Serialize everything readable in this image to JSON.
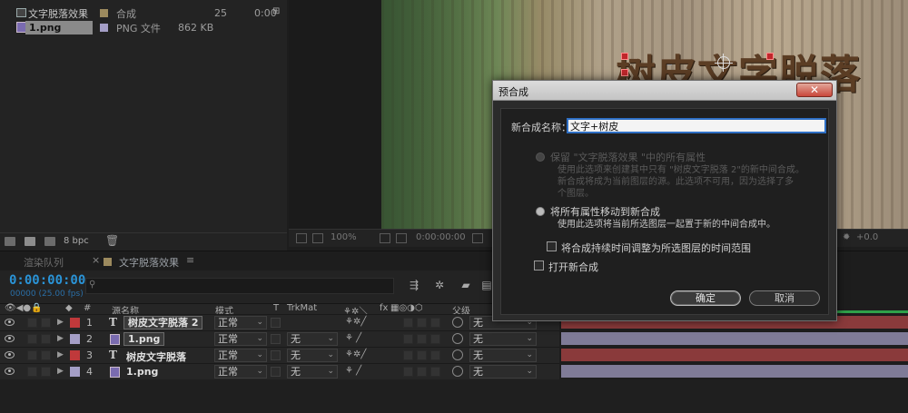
{
  "project": {
    "items": [
      {
        "name": "文字脱落效果",
        "type": "合成",
        "size": "",
        "fps": "25",
        "duration": "0:00",
        "swatch": "#9c8a5e"
      },
      {
        "name": "1.png",
        "type": "PNG 文件",
        "size": "862 KB",
        "fps": "",
        "duration": "",
        "swatch": "#a49ec6"
      }
    ],
    "bpc": "8 bpc"
  },
  "viewer": {
    "overlay_text": "树皮文字脱落",
    "zoom": "100%",
    "timecode": "0:00:00:00",
    "exposure": "+0.0"
  },
  "timeline": {
    "tabs": {
      "render_queue": "渲染队列",
      "comp": "文字脱落效果"
    },
    "timecode": "0:00:00:00",
    "fps_label": "00000 (25.00 fps)",
    "columns": {
      "num": "#",
      "source_name": "源名称",
      "mode": "模式",
      "t": "T",
      "trkmat": "TrkMat",
      "fx": "fx",
      "parent": "父级"
    },
    "layers": [
      {
        "num": "1",
        "kind": "text",
        "name": "树皮文字脱落 2",
        "mode": "正常",
        "trkmat": "",
        "parent": "无",
        "label": "#c0393b",
        "bar": "#8a3a3b"
      },
      {
        "num": "2",
        "kind": "png",
        "name": "1.png",
        "mode": "正常",
        "trkmat": "无",
        "parent": "无",
        "label": "#a49ec6",
        "bar": "#7f7b97"
      },
      {
        "num": "3",
        "kind": "text",
        "name": "树皮文字脱落",
        "mode": "正常",
        "trkmat": "无",
        "parent": "无",
        "label": "#c0393b",
        "bar": "#8a3a3b"
      },
      {
        "num": "4",
        "kind": "png",
        "name": "1.png",
        "mode": "正常",
        "trkmat": "无",
        "parent": "无",
        "label": "#a49ec6",
        "bar": "#7f7b97"
      }
    ],
    "text_icon": "T"
  },
  "dialog": {
    "title": "预合成",
    "close": "✕",
    "name_label": "新合成名称：",
    "name_value": "文字+树皮",
    "option1": {
      "label": "保留 \"文字脱落效果 \"中的所有属性",
      "desc": [
        "使用此选项来创建其中只有 \"树皮文字脱落 2\"的新中间合成。",
        "新合成将成为当前图层的源。此选项不可用，因为选择了多",
        "个图层。"
      ]
    },
    "option2": {
      "label": "将所有属性移动到新合成",
      "desc": "使用此选项将当前所选图层一起置于新的中间合成中。"
    },
    "check_adjust": "将合成持续时间调整为所选图层的时间范围",
    "check_open": "打开新合成",
    "ok": "确定",
    "cancel": "取消"
  },
  "colors": {
    "accent": "#2a93d6",
    "label_red": "#c0393b",
    "label_purple": "#a49ec6"
  }
}
